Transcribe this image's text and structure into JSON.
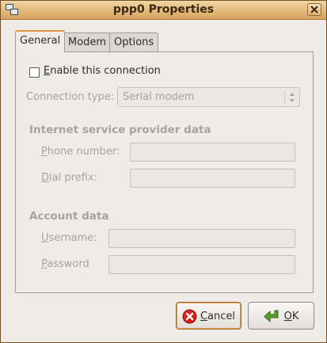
{
  "window": {
    "title": "ppp0 Properties"
  },
  "tabs": [
    {
      "label": "General",
      "active": true
    },
    {
      "label": "Modem",
      "active": false
    },
    {
      "label": "Options",
      "active": false
    }
  ],
  "general": {
    "enable_checkbox": {
      "prefix": "",
      "mnemonic": "E",
      "rest": "nable this connection",
      "checked": false
    },
    "connection_type": {
      "label": "Connection type:",
      "value": "Serial modem"
    },
    "isp_section": "Internet service provider data",
    "phone": {
      "mnemonic": "P",
      "rest": "hone number:",
      "value": ""
    },
    "dial_prefix": {
      "mnemonic": "D",
      "rest": "ial prefix:",
      "value": ""
    },
    "account_section": "Account data",
    "username": {
      "mnemonic": "U",
      "rest": "sername:",
      "value": ""
    },
    "password": {
      "mnemonic": "P",
      "rest": "assword",
      "value": ""
    }
  },
  "buttons": {
    "cancel": {
      "mnemonic": "C",
      "rest": "ancel"
    },
    "ok": {
      "mnemonic": "O",
      "rest": "K"
    }
  },
  "colors": {
    "title_bar": "#e3b978",
    "focus_accent": "#e6943f",
    "disabled_text": "#a7a39e"
  },
  "icons": {
    "window": "network-window-icon",
    "close": "close-x-icon",
    "cancel": "cancel-red-x-icon",
    "ok": "ok-green-arrow-icon",
    "combo": "up-down-arrows-icon"
  }
}
